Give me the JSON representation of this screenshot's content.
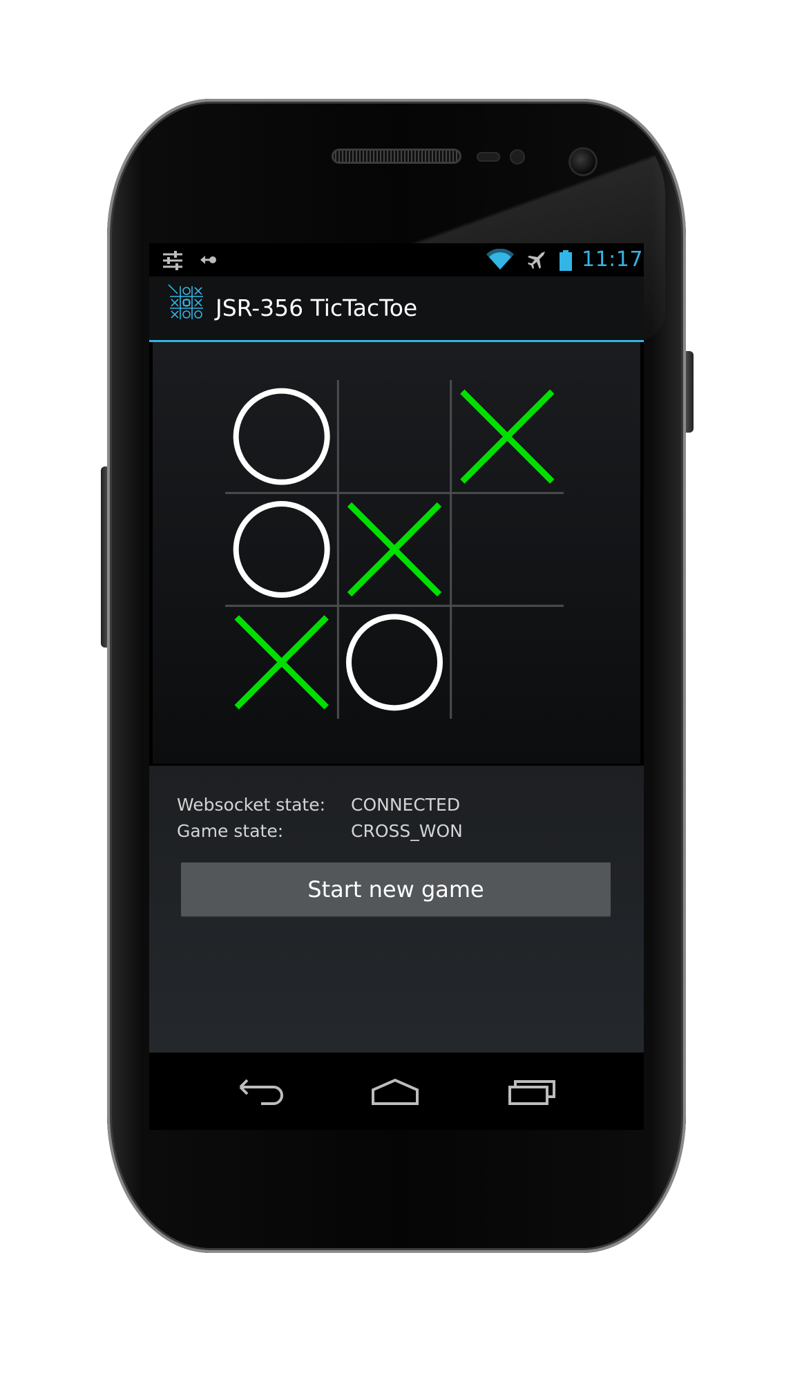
{
  "statusbar": {
    "time": "11:17",
    "icons": [
      "settings-sliders-icon",
      "usb-debug-icon",
      "wifi-icon",
      "airplane-icon",
      "battery-icon"
    ],
    "accent_color": "#33b5e5"
  },
  "actionbar": {
    "title": "JSR-356 TicTacToe",
    "icon": "tictactoe-app-icon"
  },
  "board": {
    "cells": [
      [
        "O",
        "",
        "X"
      ],
      [
        "O",
        "X",
        ""
      ],
      [
        "X",
        "O",
        ""
      ]
    ],
    "x_color": "#00e000",
    "o_color": "#ffffff",
    "grid_color": "#4a4c4e"
  },
  "info": {
    "websocket_label": "Websocket state:",
    "websocket_value": "CONNECTED",
    "game_label": "Game state:",
    "game_value": "CROSS_WON"
  },
  "actions": {
    "start_label": "Start new game"
  },
  "navbar": {
    "icons": [
      "back-icon",
      "home-icon",
      "recent-apps-icon"
    ]
  }
}
